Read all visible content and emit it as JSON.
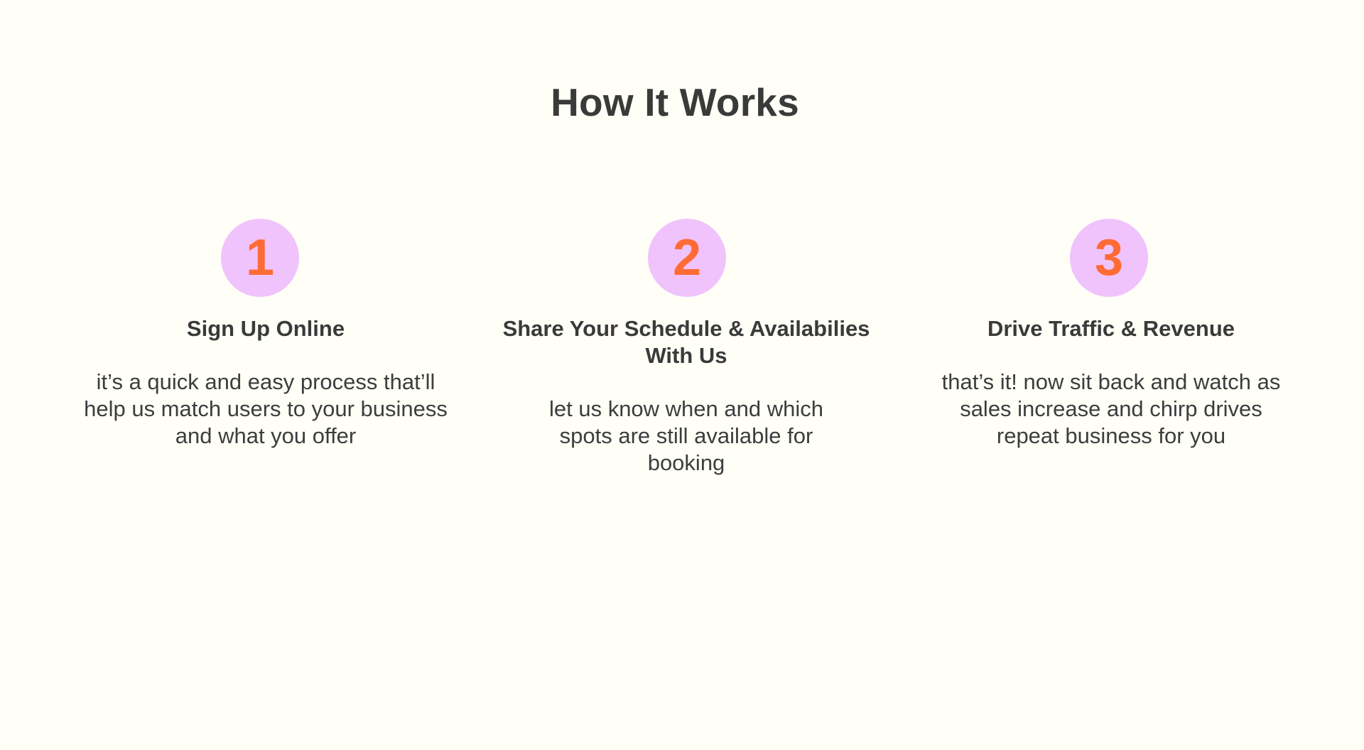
{
  "section": {
    "title": "How It Works"
  },
  "colors": {
    "background": "#FFFEF7",
    "badge_fill": "#F0C3FC",
    "badge_number": "#FF6B35",
    "text": "#3A3A3A"
  },
  "steps": [
    {
      "number": "1",
      "title": "Sign Up Online",
      "description": "it’s a quick and easy process that’ll help us match users to your business and what you offer"
    },
    {
      "number": "2",
      "title": "Share Your Schedule & Availabilies With Us",
      "description": "let us know when and which spots are still available for booking"
    },
    {
      "number": "3",
      "title": "Drive Traffic & Revenue",
      "description": "that’s it! now sit back and watch as sales increase and chirp drives repeat business for you"
    }
  ]
}
